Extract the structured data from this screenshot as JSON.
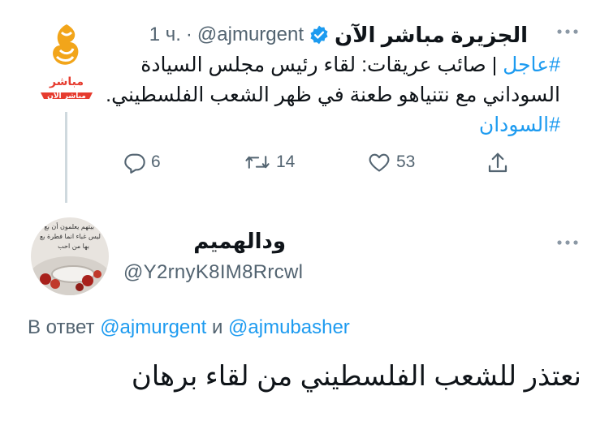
{
  "tweet": {
    "author_name": "الجزيرة مباشر الآن",
    "handle": "@ajmurgent",
    "separator": "·",
    "time": "1 ч.",
    "text_prefix": "عاجل",
    "text_hash": "#",
    "text_main": " | صائب عريقات: لقاء رئيس مجلس السيادة السوداني مع نتنياهو طعنة في ظهر الشعب الفلسطيني. ",
    "text_tag2": "#السودان",
    "avatar_logo_text": "مباشر",
    "avatar_banner_text": "مباشر الآن",
    "actions": {
      "replies": "6",
      "retweets": "14",
      "likes": "53"
    }
  },
  "reply": {
    "author_name": "ودالهميم",
    "handle": "@Y2rnyK8IM8Rrcwl",
    "avatar_caption_1": "بيتهم يعلمون أن بع",
    "avatar_caption_2": "ليس غباء انما فطرة بع",
    "avatar_caption_3": "بها من احب",
    "replying_prefix": "В ответ",
    "mention_1": "@ajmurgent",
    "conjunction": "и",
    "mention_2": "@ajmubasher",
    "text": "نعتذر للشعب الفلسطيني من لقاء برهان"
  },
  "colors": {
    "accent": "#1d9bf0",
    "secondary_text": "#536471",
    "brand_red": "#e63b2e",
    "brand_gold": "#f2a51a"
  }
}
